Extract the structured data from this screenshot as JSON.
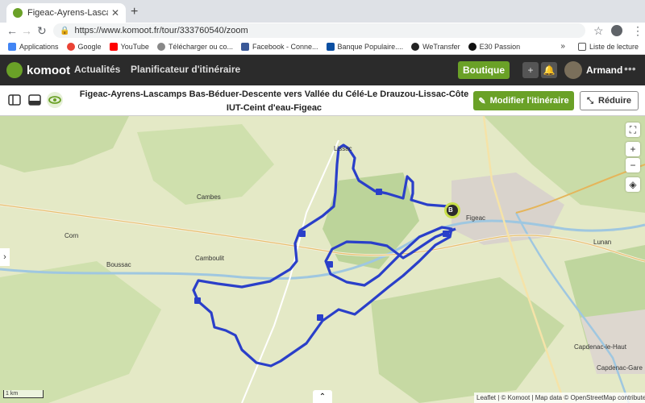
{
  "browser": {
    "tab_title": "Figeac-Ayrens-Lascamps Bas",
    "url": "https://www.komoot.fr/tour/333760540/zoom",
    "bookmarks": [
      "Applications",
      "Google",
      "YouTube",
      "Télécharger ou co...",
      "Facebook - Conne...",
      "Banque Populaire....",
      "WeTransfer",
      "E30 Passion"
    ],
    "reading_list": "Liste de lecture",
    "bookmark_colors": [
      "#4285f4",
      "#ea4335",
      "#ff0000",
      "#888888",
      "#3b5998",
      "#0b4fa2",
      "#222222",
      "#111111"
    ]
  },
  "app": {
    "logo": "komoot",
    "nav": [
      "Actualités",
      "Planificateur d'itinéraire"
    ],
    "shop": "Boutique",
    "user": "Armand",
    "accent": "#6aa127"
  },
  "tour": {
    "title_line1": "Figeac-Ayrens-Lascamps Bas-Béduer-Descente vers Vallée du Célé-Le Drauzou-Lissac-Côte",
    "title_line2": "IUT-Ceint d'eau-Figeac",
    "modify_label": "Modifier l'itinéraire",
    "reduce_label": "Réduire"
  },
  "map": {
    "places": [
      "Figeac",
      "Cambes",
      "Corn",
      "Boussac",
      "Camboulit",
      "Lunan",
      "Capdenac-le-Haut",
      "Capdenac-Gare",
      "Lissac"
    ],
    "marker_label": "B",
    "scale": "1 km",
    "attribution": "Leaflet | © Komoot | Map data © OpenStreetMap contributeurs",
    "route_color": "#2a3fc9"
  }
}
